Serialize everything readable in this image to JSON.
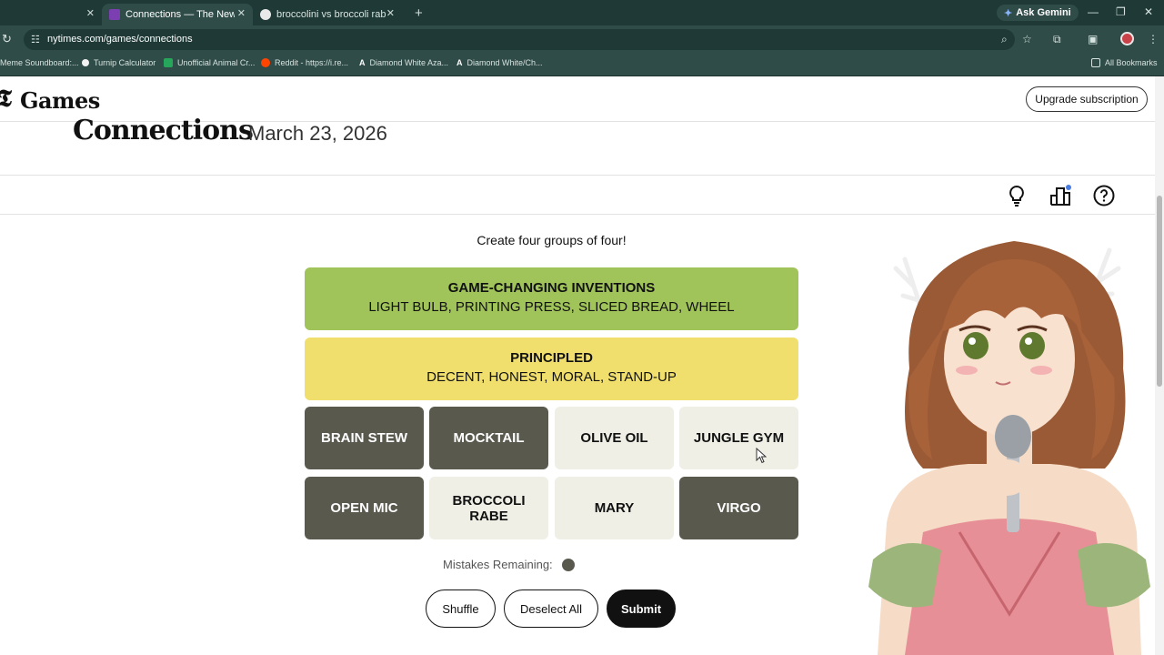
{
  "browser": {
    "tabs": [
      {
        "label": ""
      },
      {
        "label": "Connections — The New York T"
      },
      {
        "label": "broccolini vs broccoli rabe - Go"
      }
    ],
    "ask_gemini": "Ask Gemini",
    "url": "nytimes.com/games/connections",
    "bookmarks": [
      "Meme Soundboard:...",
      "Turnip Calculator",
      "Unofficial Animal Cr...",
      "Reddit - https://i.re...",
      "Diamond White Aza...",
      "Diamond White/Ch..."
    ],
    "all_bookmarks": "All Bookmarks"
  },
  "header": {
    "logo": "Games",
    "upgrade": "Upgrade subscription"
  },
  "game": {
    "title": "Connections",
    "date": "March 23, 2026",
    "instructions": "Create four groups of four!",
    "solved_groups": [
      {
        "name": "GAME-CHANGING INVENTIONS",
        "words": "LIGHT BULB, PRINTING PRESS, SLICED BREAD, WHEEL",
        "color": "#a0c35a"
      },
      {
        "name": "PRINCIPLED",
        "words": "DECENT, HONEST, MORAL, STAND-UP",
        "color": "#f0df6d"
      }
    ],
    "tiles": [
      {
        "word": "BRAIN STEW",
        "selected": true
      },
      {
        "word": "MOCKTAIL",
        "selected": true
      },
      {
        "word": "OLIVE OIL",
        "selected": false
      },
      {
        "word": "JUNGLE GYM",
        "selected": false
      },
      {
        "word": "OPEN MIC",
        "selected": true
      },
      {
        "word": "BROCCOLI RABE",
        "selected": false
      },
      {
        "word": "MARY",
        "selected": false
      },
      {
        "word": "VIRGO",
        "selected": true
      }
    ],
    "mistakes_label": "Mistakes Remaining:",
    "mistakes_remaining": 1,
    "buttons": {
      "shuffle": "Shuffle",
      "deselect": "Deselect All",
      "submit": "Submit"
    }
  },
  "colors": {
    "chrome_dark": "#1f3a36",
    "chrome": "#2f4c48",
    "selected_tile": "#5a594e",
    "tile": "#efefe6"
  }
}
